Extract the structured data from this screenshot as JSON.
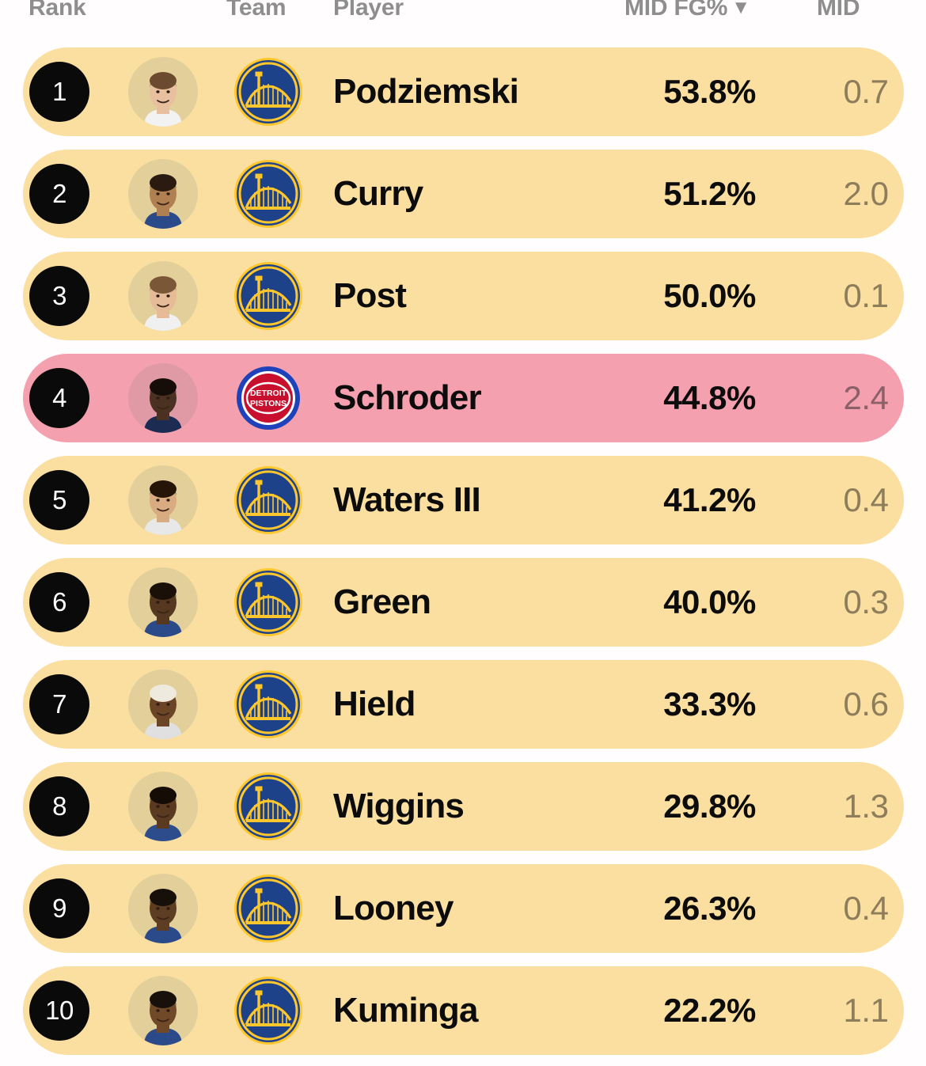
{
  "header": {
    "rank_label": "Rank",
    "team_label": "Team",
    "player_label": "Player",
    "stat_primary_label": "MID FG%",
    "sort_caret": "▼",
    "stat_secondary_label": "MID"
  },
  "colors": {
    "page_background": "#fffdfd",
    "row_background": "#fadfa0",
    "row_highlight_background": "#f5a0ae",
    "rank_badge_background": "#0a0a0a",
    "rank_badge_text": "#ffffff",
    "primary_stat_text": "#0c0c0c",
    "secondary_stat_text": "#8d7d5b",
    "header_text": "#8e8e8e",
    "warriors_blue": "#1d428a",
    "warriors_gold": "#ffc72c",
    "pistons_red": "#c8102e",
    "pistons_blue": "#1d42ba"
  },
  "rows": [
    {
      "rank": "1",
      "player": "Podziemski",
      "team": "GSW",
      "team_icon": "warriors-logo",
      "avatar_icon": "player-headshot",
      "stat_primary": "53.8%",
      "stat_secondary": "0.7",
      "highlighted": false,
      "skin": "#e8c0a0",
      "hair": "#6b4a2f",
      "jersey": "#f2f2f2"
    },
    {
      "rank": "2",
      "player": "Curry",
      "team": "GSW",
      "team_icon": "warriors-logo",
      "avatar_icon": "player-headshot",
      "stat_primary": "51.2%",
      "stat_secondary": "2.0",
      "highlighted": false,
      "skin": "#b07f52",
      "hair": "#2a1a10",
      "jersey": "#2a4a8a"
    },
    {
      "rank": "3",
      "player": "Post",
      "team": "GSW",
      "team_icon": "warriors-logo",
      "avatar_icon": "player-headshot",
      "stat_primary": "50.0%",
      "stat_secondary": "0.1",
      "highlighted": false,
      "skin": "#e6bb97",
      "hair": "#7a5736",
      "jersey": "#f0f0f0"
    },
    {
      "rank": "4",
      "player": "Schroder",
      "team": "DET",
      "team_icon": "pistons-logo",
      "avatar_icon": "player-headshot",
      "stat_primary": "44.8%",
      "stat_secondary": "2.4",
      "highlighted": true,
      "skin": "#4a3122",
      "hair": "#160d08",
      "jersey": "#1b2b52"
    },
    {
      "rank": "5",
      "player": "Waters III",
      "team": "GSW",
      "team_icon": "warriors-logo",
      "avatar_icon": "player-headshot",
      "stat_primary": "41.2%",
      "stat_secondary": "0.4",
      "highlighted": false,
      "skin": "#d9ab80",
      "hair": "#241508",
      "jersey": "#e8e8e8"
    },
    {
      "rank": "6",
      "player": "Green",
      "team": "GSW",
      "team_icon": "warriors-logo",
      "avatar_icon": "player-headshot",
      "stat_primary": "40.0%",
      "stat_secondary": "0.3",
      "highlighted": false,
      "skin": "#55381f",
      "hair": "#1a1008",
      "jersey": "#2a4a8a"
    },
    {
      "rank": "7",
      "player": "Hield",
      "team": "GSW",
      "team_icon": "warriors-logo",
      "avatar_icon": "player-headshot",
      "stat_primary": "33.3%",
      "stat_secondary": "0.6",
      "highlighted": false,
      "skin": "#6b4526",
      "hair": "#efeade",
      "jersey": "#e0e0e0"
    },
    {
      "rank": "8",
      "player": "Wiggins",
      "team": "GSW",
      "team_icon": "warriors-logo",
      "avatar_icon": "player-headshot",
      "stat_primary": "29.8%",
      "stat_secondary": "1.3",
      "highlighted": false,
      "skin": "#5a3a20",
      "hair": "#150c06",
      "jersey": "#2c4c8c"
    },
    {
      "rank": "9",
      "player": "Looney",
      "team": "GSW",
      "team_icon": "warriors-logo",
      "avatar_icon": "player-headshot",
      "stat_primary": "26.3%",
      "stat_secondary": "0.4",
      "highlighted": false,
      "skin": "#5e3e23",
      "hair": "#17100a",
      "jersey": "#2a4a8a"
    },
    {
      "rank": "10",
      "player": "Kuminga",
      "team": "GSW",
      "team_icon": "warriors-logo",
      "avatar_icon": "player-headshot",
      "stat_primary": "22.2%",
      "stat_secondary": "1.1",
      "highlighted": false,
      "skin": "#704a28",
      "hair": "#18100a",
      "jersey": "#2a4a8a"
    }
  ]
}
